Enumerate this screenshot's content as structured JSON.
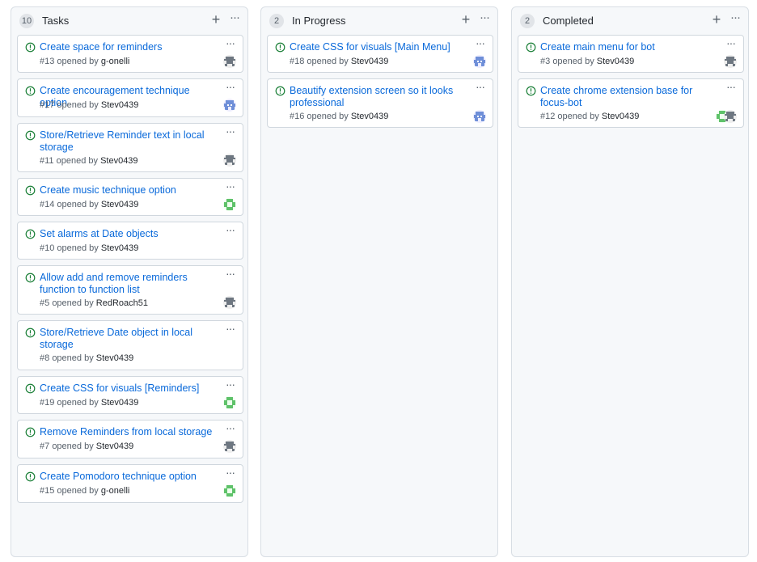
{
  "columns": [
    {
      "name": "Tasks",
      "count": "10",
      "cards": [
        {
          "title": "Create space for reminders",
          "number": "#13",
          "author": "g-onelli"
        },
        {
          "title": "Create encouragement technique option",
          "number": "#17",
          "author": "Stev0439"
        },
        {
          "title": "Store/Retrieve Reminder text in local storage",
          "number": "#11",
          "author": "Stev0439"
        },
        {
          "title": "Create music technique option",
          "number": "#14",
          "author": "Stev0439"
        },
        {
          "title": "Set alarms at Date objects",
          "number": "#10",
          "author": "Stev0439"
        },
        {
          "title": "Allow add and remove reminders function to function list",
          "number": "#5",
          "author": "RedRoach51"
        },
        {
          "title": "Store/Retrieve Date object in local storage",
          "number": "#8",
          "author": "Stev0439"
        },
        {
          "title": "Create CSS for visuals [Reminders]",
          "number": "#19",
          "author": "Stev0439"
        },
        {
          "title": "Remove Reminders from local storage",
          "number": "#7",
          "author": "Stev0439"
        },
        {
          "title": "Create Pomodoro technique option",
          "number": "#15",
          "author": "g-onelli"
        }
      ]
    },
    {
      "name": "In Progress",
      "count": "2",
      "cards": [
        {
          "title": "Create CSS for visuals [Main Menu]",
          "number": "#18",
          "author": "Stev0439"
        },
        {
          "title": "Beautify extension screen so it looks professional",
          "number": "#16",
          "author": "Stev0439"
        }
      ]
    },
    {
      "name": "Completed",
      "count": "2",
      "cards": [
        {
          "title": "Create main menu for bot",
          "number": "#3",
          "author": "Stev0439"
        },
        {
          "title": "Create chrome extension base for focus-bot",
          "number": "#12",
          "author": "Stev0439"
        }
      ]
    }
  ],
  "labels": {
    "opened_by": "opened by",
    "add": "+",
    "more": "···"
  },
  "colors": {
    "link": "#0969da",
    "issue_open": "#1a7f37",
    "avatar_gray": "#6e7781",
    "avatar_blue": "#6f8fd8",
    "avatar_green": "#5fc26a"
  }
}
